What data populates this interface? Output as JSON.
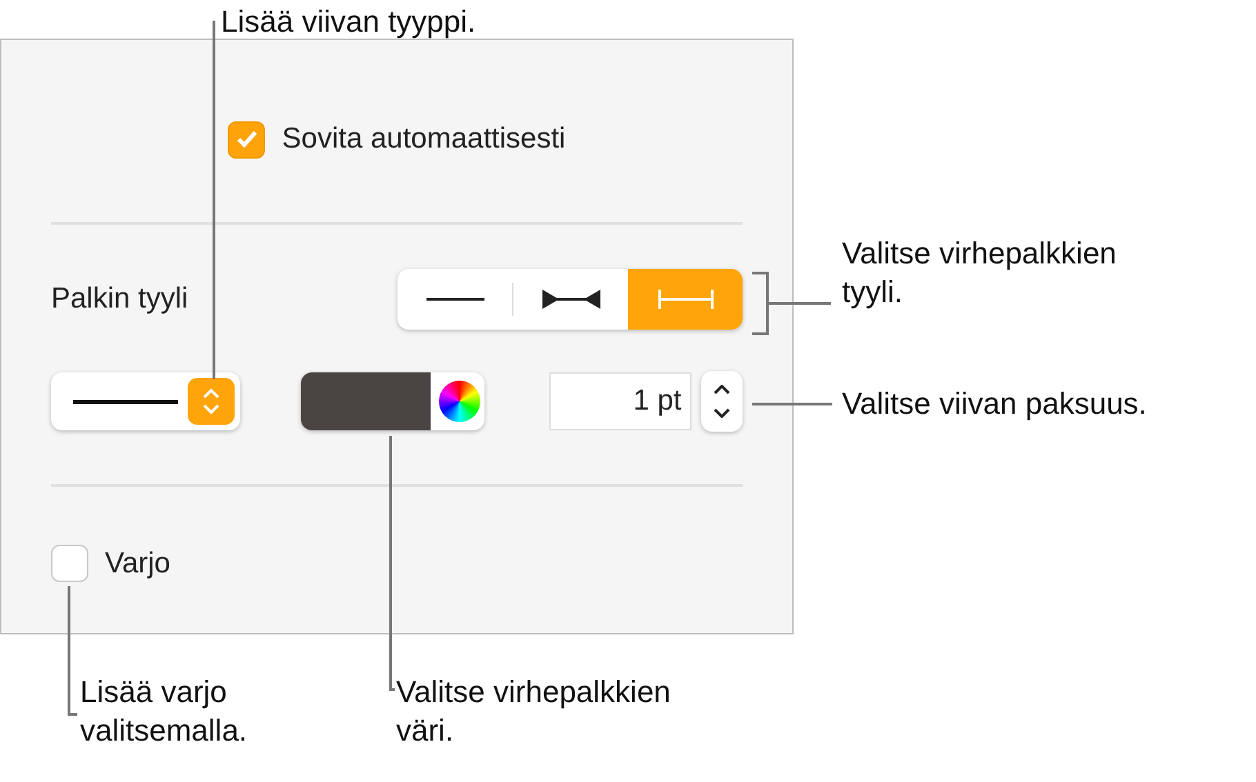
{
  "panel": {
    "autofit": {
      "label": "Sovita automaattisesti",
      "checked": true
    },
    "bar_style": {
      "label": "Palkin tyyli",
      "options": [
        {
          "kind": "plain",
          "selected": false
        },
        {
          "kind": "arrows",
          "selected": false
        },
        {
          "kind": "caps",
          "selected": true
        }
      ]
    },
    "thickness": {
      "value": "1 pt"
    },
    "shadow": {
      "label": "Varjo",
      "checked": false
    }
  },
  "callouts": [
    {
      "text": "Lisää viivan tyyppi."
    },
    {
      "text": "Valitse virhepalkkien tyyli."
    },
    {
      "text": "Valitse viivan paksuus."
    },
    {
      "text": "Lisää varjo valitsemalla."
    },
    {
      "text": "Valitse virhepalkkien väri."
    }
  ]
}
